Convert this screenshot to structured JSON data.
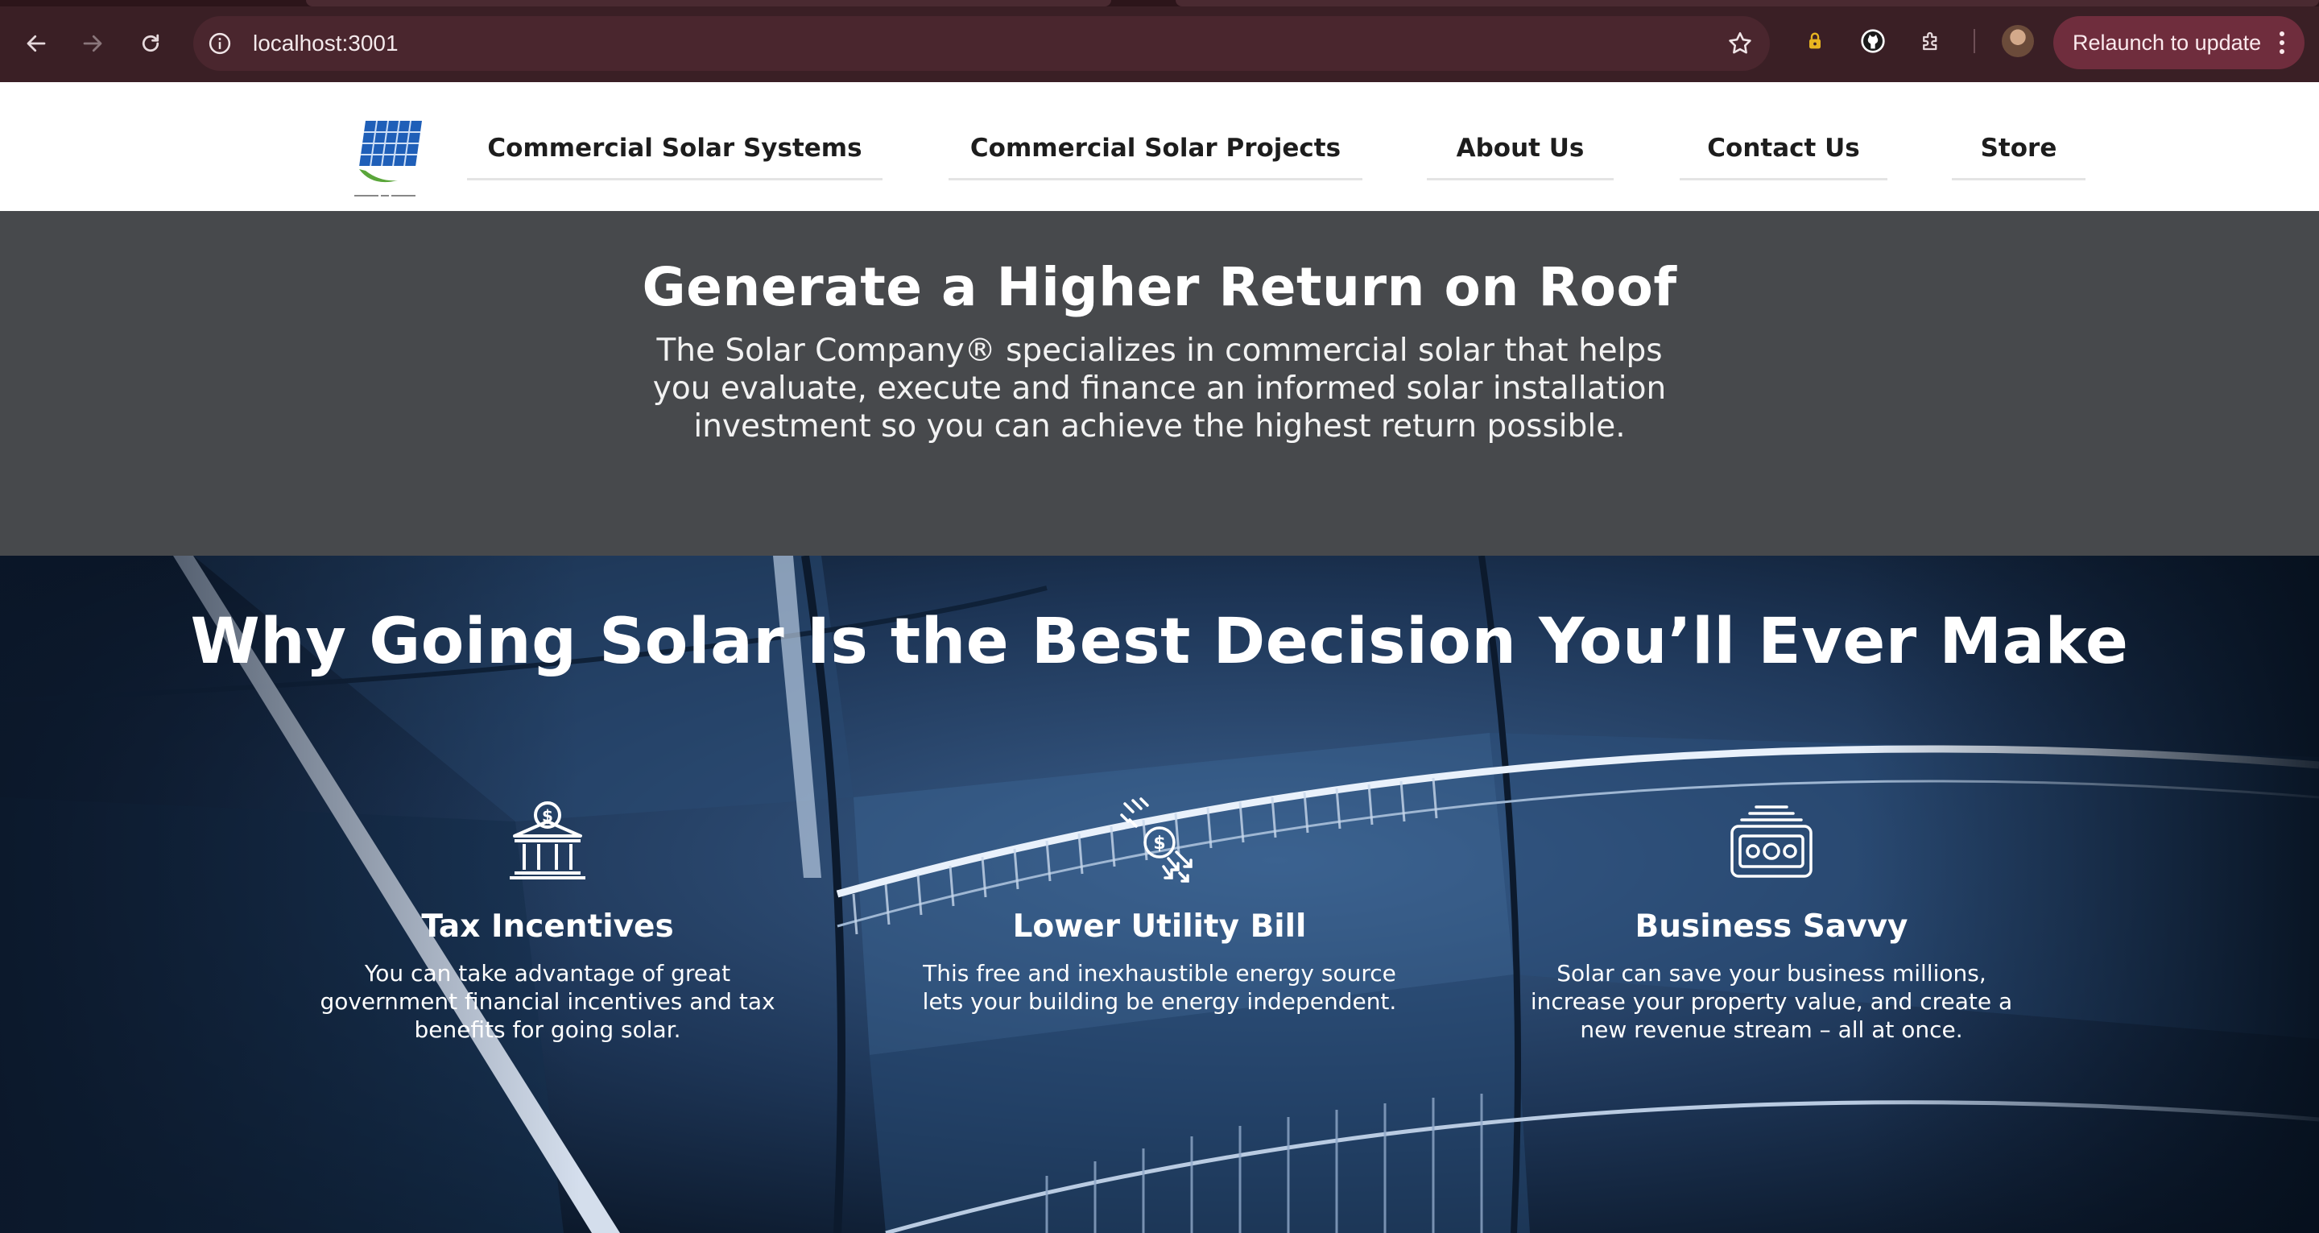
{
  "browser": {
    "url": "localhost:3001",
    "relaunch_label": "Relaunch to update"
  },
  "nav": {
    "items": [
      {
        "label": "Commercial Solar Systems"
      },
      {
        "label": "Commercial Solar Projects"
      },
      {
        "label": "About Us"
      },
      {
        "label": "Contact Us"
      },
      {
        "label": "Store"
      }
    ]
  },
  "hero": {
    "title": "Generate a Higher Return on Roof",
    "text": "The Solar Company® specializes in commercial solar that helps you evaluate, execute and finance an informed solar installation investment so you can achieve the highest return possible."
  },
  "benefits": {
    "heading": "Why Going Solar Is the Best Decision You’ll Ever Make",
    "features": [
      {
        "icon": "bank-dollar-icon",
        "title": "Tax Incentives",
        "text": "You can take advantage of great government financial incentives and tax benefits for going solar."
      },
      {
        "icon": "falling-coin-icon",
        "title": "Lower Utility Bill",
        "text": "This free and inexhaustible energy source lets your building be energy independent."
      },
      {
        "icon": "cash-stack-icon",
        "title": "Business Savvy",
        "text": "Solar can save your business millions, increase your property value, and create a new revenue stream – all at once."
      }
    ]
  },
  "colors": {
    "chrome": "#3a1f25",
    "hero_bg": "#47494c",
    "benefits_bg": "#0c1b30",
    "relaunch_bg": "#6f2d3d"
  }
}
